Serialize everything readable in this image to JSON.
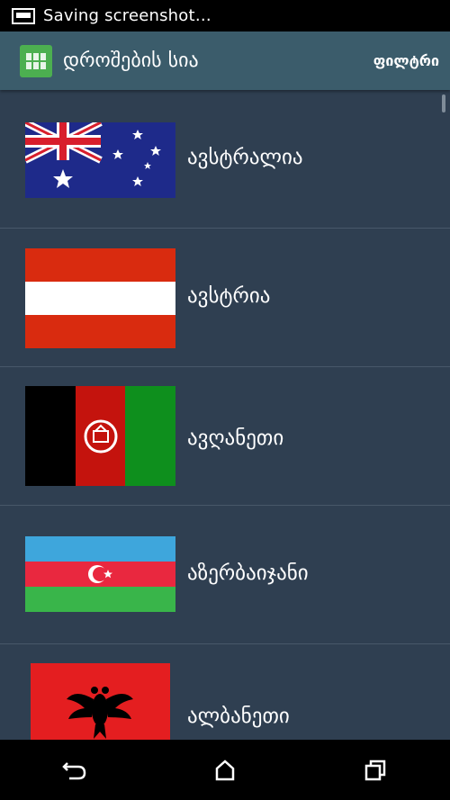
{
  "status_bar": {
    "text": "Saving screenshot…",
    "icon": "screenshot-icon"
  },
  "header": {
    "title": "დროშების სია",
    "filter_label": "ფილტრი",
    "icon": "grid-app-icon",
    "bg_color": "#3b5c6b"
  },
  "list": {
    "items": [
      {
        "name": "ავსტრალია",
        "flag": "australia-flag"
      },
      {
        "name": "ავსტრია",
        "flag": "austria-flag"
      },
      {
        "name": "ავღანეთი",
        "flag": "afghanistan-flag"
      },
      {
        "name": "აზერბაიჯანი",
        "flag": "azerbaijan-flag"
      },
      {
        "name": "ალბანეთი",
        "flag": "albania-flag"
      }
    ]
  },
  "nav_bar": {
    "back": "back-icon",
    "home": "home-icon",
    "recents": "recents-icon"
  }
}
